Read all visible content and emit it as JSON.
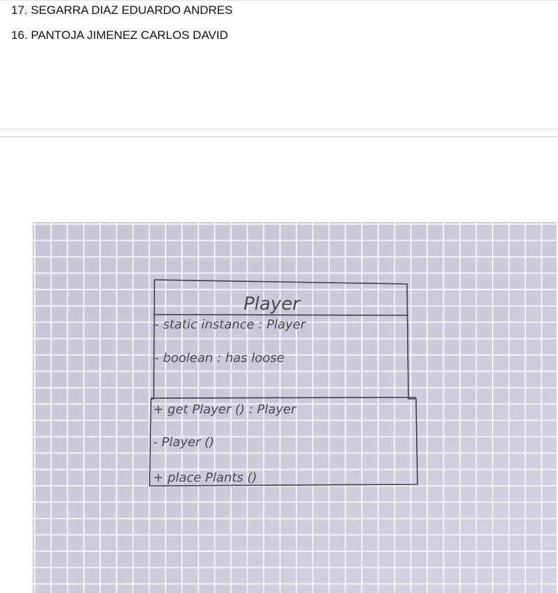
{
  "students": [
    "17. SEGARRA DIAZ EDUARDO ANDRES",
    "16. PANTOJA JIMENEZ CARLOS DAVID"
  ],
  "diagram": {
    "class_name": "Player",
    "attributes": [
      "- static instance : Player",
      "- boolean : has loose"
    ],
    "methods": [
      "+ get Player () : Player",
      "- Player ()",
      "+ place Plants ()"
    ]
  },
  "colors": {
    "paper": "#c9cad6",
    "grid": "#eef0f6",
    "pencil": "#4a4a52",
    "text": "#111111"
  }
}
